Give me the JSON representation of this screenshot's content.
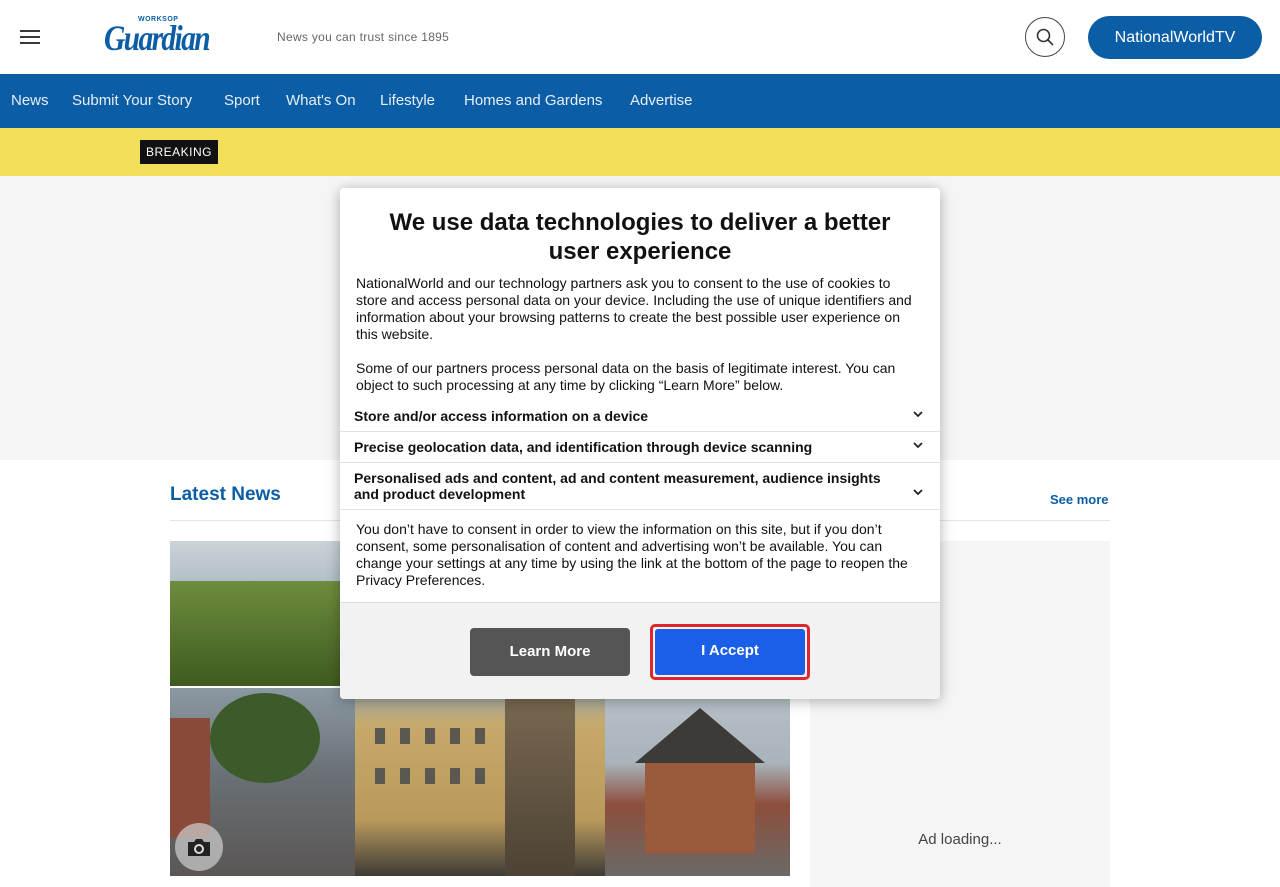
{
  "header": {
    "logo_small": "WORKSOP",
    "logo_main": "Guardian",
    "tagline": "News you can trust since 1895",
    "tv_label": "NationalWorldTV"
  },
  "nav": {
    "items": [
      {
        "label": "News"
      },
      {
        "label": "Submit Your Story"
      },
      {
        "label": "Sport"
      },
      {
        "label": "What's On"
      },
      {
        "label": "Lifestyle"
      },
      {
        "label": "Homes and Gardens"
      },
      {
        "label": "Advertise"
      }
    ]
  },
  "breaking": {
    "badge": "BREAKING"
  },
  "latest": {
    "title": "Latest News",
    "see_more": "See more"
  },
  "ad": {
    "loading": "Ad loading..."
  },
  "consent": {
    "title": "We use data technologies to deliver a better user experience",
    "para1": "NationalWorld and our technology partners ask you to consent to the use of cookies to store and access personal data on your device. Including the use of unique identifiers and information about your browsing patterns to create the best possible user experience on this website.",
    "para2": "Some of our partners process personal data on the basis of legitimate interest. You can object to such processing at any time by clicking “Learn More” below.",
    "purposes": [
      {
        "label": "Store and/or access information on a device"
      },
      {
        "label": "Precise geolocation data, and identification through device scanning"
      },
      {
        "label": "Personalised ads and content, ad and content measurement, audience insights and product development"
      }
    ],
    "para3": "You don’t have to consent in order to view the information on this site, but if you don’t consent, some personalisation of content and advertising won’t be available. You can change your settings at any time by using the link at the bottom of the page to reopen the Privacy Preferences.",
    "learn_more": "Learn More",
    "accept": "I Accept"
  },
  "colors": {
    "brand_blue": "#0b5ea6",
    "breaking_yellow": "#f3df5a",
    "accept_blue": "#1a5fe8",
    "highlight_red": "#e0262d"
  },
  "icons": {
    "menu": "hamburger-menu-icon",
    "search": "search-icon",
    "camera": "camera-icon",
    "chevron": "chevron-down-icon"
  }
}
